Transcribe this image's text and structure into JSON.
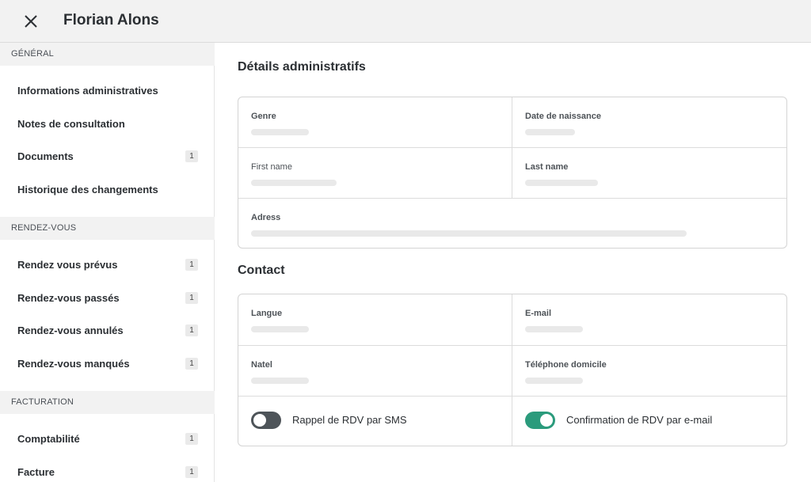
{
  "header": {
    "title": "Florian Alons",
    "close_icon": "close-icon"
  },
  "sidebar": {
    "sections": [
      {
        "title": "GÉNÉRAL",
        "items": [
          {
            "label": "Informations administratives",
            "count": ""
          },
          {
            "label": "Notes de consultation",
            "count": ""
          },
          {
            "label": "Documents",
            "count": "1"
          },
          {
            "label": "Historique des changements",
            "count": ""
          }
        ]
      },
      {
        "title": "RENDEZ-VOUS",
        "items": [
          {
            "label": "Rendez vous prévus",
            "count": "1"
          },
          {
            "label": "Rendez-vous passés",
            "count": "1"
          },
          {
            "label": "Rendez-vous annulés",
            "count": "1"
          },
          {
            "label": "Rendez-vous manqués",
            "count": "1"
          }
        ]
      },
      {
        "title": "FACTURATION",
        "items": [
          {
            "label": "Comptabilité",
            "count": "1"
          },
          {
            "label": "Facture",
            "count": "1"
          }
        ]
      }
    ]
  },
  "admin": {
    "title": "Détails administratifs",
    "fields": {
      "gender": "Genre",
      "birthdate": "Date de naissance",
      "first_name": "First name",
      "last_name": "Last name",
      "address": "Adress"
    }
  },
  "contact": {
    "title": "Contact",
    "fields": {
      "language": "Langue",
      "email": "E-mail",
      "mobile": "Natel",
      "home_phone": "Téléphone domicile"
    },
    "toggles": {
      "sms_reminder": {
        "label": "Rappel de RDV par SMS",
        "state": "off"
      },
      "email_confirmation": {
        "label": "Confirmation de RDV par e-mail",
        "state": "on"
      }
    }
  },
  "colors": {
    "accent": "#2b9b7c",
    "toggle_off": "#4e5459",
    "sidebar_header_bg": "#f2f2f2"
  }
}
